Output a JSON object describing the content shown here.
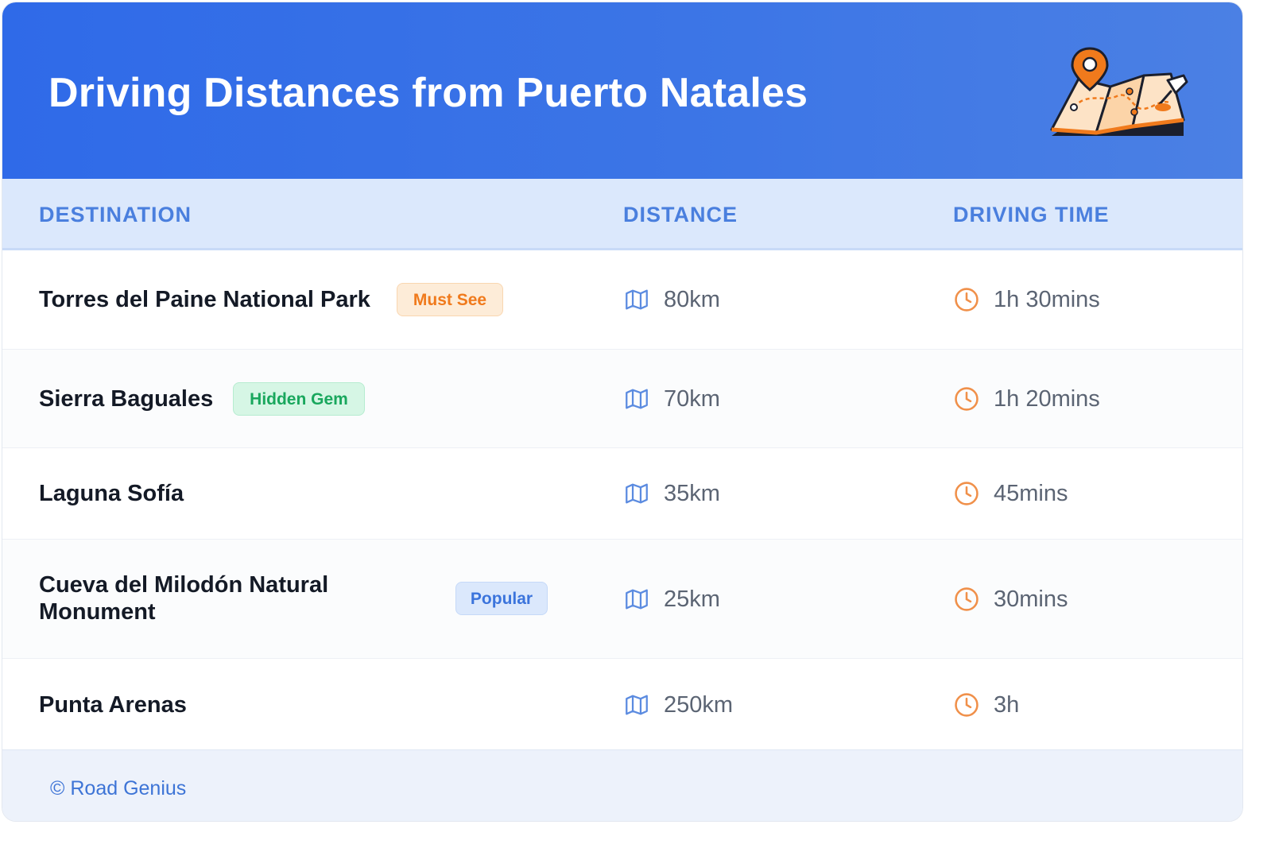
{
  "header": {
    "title": "Driving Distances from Puerto Natales",
    "illustration_icon": "folded-map-with-pins-icon",
    "gradient_colors": [
      "#2f6ae8",
      "#4b80e4"
    ]
  },
  "columns": {
    "destination": "DESTINATION",
    "distance": "DISTANCE",
    "driving_time": "DRIVING TIME"
  },
  "rows": [
    {
      "destination": "Torres del Paine National Park",
      "badge": "Must See",
      "badge_color": "#f07a1c",
      "distance": "80km",
      "time": "1h 30mins"
    },
    {
      "destination": "Sierra Baguales",
      "badge": "Hidden Gem",
      "badge_color": "#19a75d",
      "distance": "70km",
      "time": "1h 20mins"
    },
    {
      "destination": "Laguna Sofía",
      "badge": "",
      "distance": "35km",
      "time": "45mins"
    },
    {
      "destination": "Cueva del Milodón Natural Monument",
      "badge": "Popular",
      "badge_color": "#3b74dc",
      "distance": "25km",
      "time": "30mins"
    },
    {
      "destination": "Punta Arenas",
      "badge": "",
      "distance": "250km",
      "time": "3h"
    }
  ],
  "icons": {
    "distance": "map-icon",
    "time": "clock-icon"
  },
  "footer": {
    "text": "© Road Genius"
  }
}
